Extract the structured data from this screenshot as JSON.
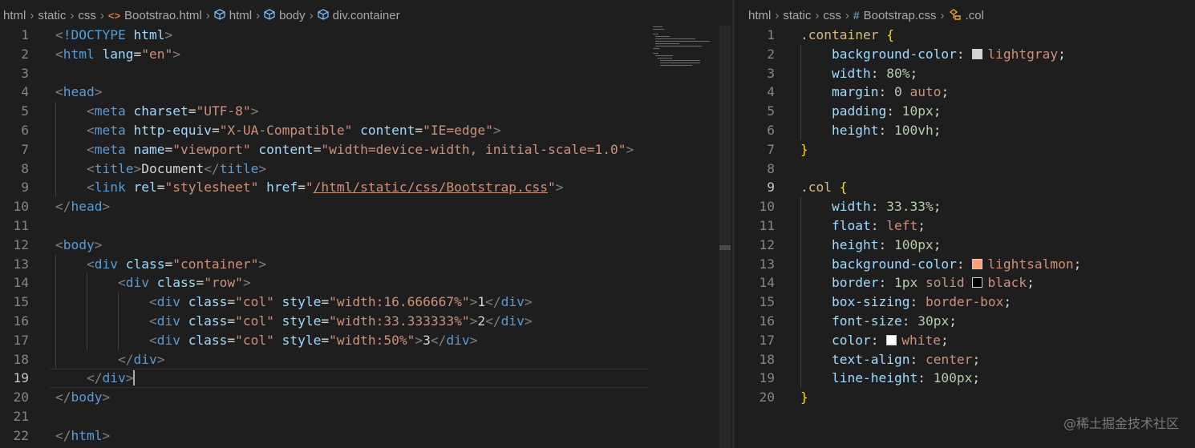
{
  "left_editor": {
    "breadcrumb": [
      {
        "label": "html",
        "icon": ""
      },
      {
        "label": "static",
        "icon": ""
      },
      {
        "label": "css",
        "icon": ""
      },
      {
        "label": "Bootstrao.html",
        "icon": "html-file-icon"
      },
      {
        "label": "html",
        "icon": "cube-icon"
      },
      {
        "label": "body",
        "icon": "cube-icon"
      },
      {
        "label": "div.container",
        "icon": "cube-icon"
      }
    ],
    "line_numbers": [
      "1",
      "2",
      "3",
      "4",
      "5",
      "6",
      "7",
      "8",
      "9",
      "10",
      "11",
      "12",
      "13",
      "14",
      "15",
      "16",
      "17",
      "18",
      "19",
      "20",
      "21",
      "22"
    ],
    "active_line": 19
  },
  "right_editor": {
    "breadcrumb": [
      {
        "label": "html",
        "icon": ""
      },
      {
        "label": "static",
        "icon": ""
      },
      {
        "label": "css",
        "icon": ""
      },
      {
        "label": "Bootstrap.css",
        "icon": "hash-icon"
      },
      {
        "label": ".col",
        "icon": "class-selector-icon"
      }
    ],
    "line_numbers": [
      "1",
      "2",
      "3",
      "4",
      "5",
      "6",
      "7",
      "8",
      "9",
      "10",
      "11",
      "12",
      "13",
      "14",
      "15",
      "16",
      "17",
      "18",
      "19",
      "20"
    ],
    "active_line": 9
  },
  "html_code": [
    [
      [
        "t-brk",
        "<"
      ],
      [
        "t-tag",
        "!DOCTYPE "
      ],
      [
        "t-attr",
        "html"
      ],
      [
        "t-brk",
        ">"
      ]
    ],
    [
      [
        "t-brk",
        "<"
      ],
      [
        "t-tag",
        "html "
      ],
      [
        "t-attr",
        "lang"
      ],
      [
        "t-txt",
        "="
      ],
      [
        "t-str",
        "\"en\""
      ],
      [
        "t-brk",
        ">"
      ]
    ],
    [],
    [
      [
        "t-brk",
        "<"
      ],
      [
        "t-tag",
        "head"
      ],
      [
        "t-brk",
        ">"
      ]
    ],
    [
      [
        "t-txt",
        "    "
      ],
      [
        "t-brk",
        "<"
      ],
      [
        "t-tag",
        "meta "
      ],
      [
        "t-attr",
        "charset"
      ],
      [
        "t-txt",
        "="
      ],
      [
        "t-str",
        "\"UTF-8\""
      ],
      [
        "t-brk",
        ">"
      ]
    ],
    [
      [
        "t-txt",
        "    "
      ],
      [
        "t-brk",
        "<"
      ],
      [
        "t-tag",
        "meta "
      ],
      [
        "t-attr",
        "http-equiv"
      ],
      [
        "t-txt",
        "="
      ],
      [
        "t-str",
        "\"X-UA-Compatible\" "
      ],
      [
        "t-attr",
        "content"
      ],
      [
        "t-txt",
        "="
      ],
      [
        "t-str",
        "\"IE=edge\""
      ],
      [
        "t-brk",
        ">"
      ]
    ],
    [
      [
        "t-txt",
        "    "
      ],
      [
        "t-brk",
        "<"
      ],
      [
        "t-tag",
        "meta "
      ],
      [
        "t-attr",
        "name"
      ],
      [
        "t-txt",
        "="
      ],
      [
        "t-str",
        "\"viewport\" "
      ],
      [
        "t-attr",
        "content"
      ],
      [
        "t-txt",
        "="
      ],
      [
        "t-str",
        "\"width=device-width, initial-scale=1.0\""
      ],
      [
        "t-brk",
        ">"
      ]
    ],
    [
      [
        "t-txt",
        "    "
      ],
      [
        "t-brk",
        "<"
      ],
      [
        "t-tag",
        "title"
      ],
      [
        "t-brk",
        ">"
      ],
      [
        "t-txt",
        "Document"
      ],
      [
        "t-brk",
        "</"
      ],
      [
        "t-tag",
        "title"
      ],
      [
        "t-brk",
        ">"
      ]
    ],
    [
      [
        "t-txt",
        "    "
      ],
      [
        "t-brk",
        "<"
      ],
      [
        "t-tag",
        "link "
      ],
      [
        "t-attr",
        "rel"
      ],
      [
        "t-txt",
        "="
      ],
      [
        "t-str",
        "\"stylesheet\" "
      ],
      [
        "t-attr",
        "href"
      ],
      [
        "t-txt",
        "="
      ],
      [
        "t-str",
        "\""
      ],
      [
        "t-str t-link",
        "/html/static/css/Bootstrap.css"
      ],
      [
        "t-str",
        "\""
      ],
      [
        "t-brk",
        ">"
      ]
    ],
    [
      [
        "t-brk",
        "</"
      ],
      [
        "t-tag",
        "head"
      ],
      [
        "t-brk",
        ">"
      ]
    ],
    [],
    [
      [
        "t-brk",
        "<"
      ],
      [
        "t-tag",
        "body"
      ],
      [
        "t-brk",
        ">"
      ]
    ],
    [
      [
        "t-txt",
        "    "
      ],
      [
        "t-brk",
        "<"
      ],
      [
        "t-tag",
        "div "
      ],
      [
        "t-attr",
        "class"
      ],
      [
        "t-txt",
        "="
      ],
      [
        "t-str",
        "\"container\""
      ],
      [
        "t-brk",
        ">"
      ]
    ],
    [
      [
        "t-txt",
        "        "
      ],
      [
        "t-brk",
        "<"
      ],
      [
        "t-tag",
        "div "
      ],
      [
        "t-attr",
        "class"
      ],
      [
        "t-txt",
        "="
      ],
      [
        "t-str",
        "\"row\""
      ],
      [
        "t-brk",
        ">"
      ]
    ],
    [
      [
        "t-txt",
        "            "
      ],
      [
        "t-brk",
        "<"
      ],
      [
        "t-tag",
        "div "
      ],
      [
        "t-attr",
        "class"
      ],
      [
        "t-txt",
        "="
      ],
      [
        "t-str",
        "\"col\" "
      ],
      [
        "t-attr",
        "style"
      ],
      [
        "t-txt",
        "="
      ],
      [
        "t-str",
        "\"width:16.666667%\""
      ],
      [
        "t-brk",
        ">"
      ],
      [
        "t-txt",
        "1"
      ],
      [
        "t-brk",
        "</"
      ],
      [
        "t-tag",
        "div"
      ],
      [
        "t-brk",
        ">"
      ]
    ],
    [
      [
        "t-txt",
        "            "
      ],
      [
        "t-brk",
        "<"
      ],
      [
        "t-tag",
        "div "
      ],
      [
        "t-attr",
        "class"
      ],
      [
        "t-txt",
        "="
      ],
      [
        "t-str",
        "\"col\" "
      ],
      [
        "t-attr",
        "style"
      ],
      [
        "t-txt",
        "="
      ],
      [
        "t-str",
        "\"width:33.333333%\""
      ],
      [
        "t-brk",
        ">"
      ],
      [
        "t-txt",
        "2"
      ],
      [
        "t-brk",
        "</"
      ],
      [
        "t-tag",
        "div"
      ],
      [
        "t-brk",
        ">"
      ]
    ],
    [
      [
        "t-txt",
        "            "
      ],
      [
        "t-brk",
        "<"
      ],
      [
        "t-tag",
        "div "
      ],
      [
        "t-attr",
        "class"
      ],
      [
        "t-txt",
        "="
      ],
      [
        "t-str",
        "\"col\" "
      ],
      [
        "t-attr",
        "style"
      ],
      [
        "t-txt",
        "="
      ],
      [
        "t-str",
        "\"width:50%\""
      ],
      [
        "t-brk",
        ">"
      ],
      [
        "t-txt",
        "3"
      ],
      [
        "t-brk",
        "</"
      ],
      [
        "t-tag",
        "div"
      ],
      [
        "t-brk",
        ">"
      ]
    ],
    [
      [
        "t-txt",
        "        "
      ],
      [
        "t-brk",
        "</"
      ],
      [
        "t-tag",
        "div"
      ],
      [
        "t-brk",
        ">"
      ]
    ],
    [
      [
        "t-txt",
        "    "
      ],
      [
        "t-brk",
        "</"
      ],
      [
        "t-tag",
        "div"
      ],
      [
        "t-brk",
        ">"
      ],
      [
        "caret",
        ""
      ]
    ],
    [
      [
        "t-brk",
        "</"
      ],
      [
        "t-tag",
        "body"
      ],
      [
        "t-brk",
        ">"
      ]
    ],
    [],
    [
      [
        "t-brk",
        "</"
      ],
      [
        "t-tag",
        "html"
      ],
      [
        "t-brk",
        ">"
      ]
    ]
  ],
  "css_code": [
    [
      [
        "t-sel",
        ".container "
      ],
      [
        "t-brace",
        "{"
      ]
    ],
    [
      [
        "t-txt",
        "    "
      ],
      [
        "t-prop",
        "background-color"
      ],
      [
        "t-punc",
        ": "
      ],
      [
        "swatch",
        "#d3d3d3"
      ],
      [
        "t-val",
        "lightgray"
      ],
      [
        "t-punc",
        ";"
      ]
    ],
    [
      [
        "t-txt",
        "    "
      ],
      [
        "t-prop",
        "width"
      ],
      [
        "t-punc",
        ": "
      ],
      [
        "t-num",
        "80%"
      ],
      [
        "t-punc",
        ";"
      ]
    ],
    [
      [
        "t-txt",
        "    "
      ],
      [
        "t-prop",
        "margin"
      ],
      [
        "t-punc",
        ": "
      ],
      [
        "t-num",
        "0 "
      ],
      [
        "t-val",
        "auto"
      ],
      [
        "t-punc",
        ";"
      ]
    ],
    [
      [
        "t-txt",
        "    "
      ],
      [
        "t-prop",
        "padding"
      ],
      [
        "t-punc",
        ": "
      ],
      [
        "t-num",
        "10px"
      ],
      [
        "t-punc",
        ";"
      ]
    ],
    [
      [
        "t-txt",
        "    "
      ],
      [
        "t-prop",
        "height"
      ],
      [
        "t-punc",
        ": "
      ],
      [
        "t-num",
        "100vh"
      ],
      [
        "t-punc",
        ";"
      ]
    ],
    [
      [
        "t-brace",
        "}"
      ]
    ],
    [],
    [
      [
        "t-sel",
        ".col "
      ],
      [
        "t-brace",
        "{"
      ]
    ],
    [
      [
        "t-txt",
        "    "
      ],
      [
        "t-prop",
        "width"
      ],
      [
        "t-punc",
        ": "
      ],
      [
        "t-num",
        "33.33%"
      ],
      [
        "t-punc",
        ";"
      ]
    ],
    [
      [
        "t-txt",
        "    "
      ],
      [
        "t-prop",
        "float"
      ],
      [
        "t-punc",
        ": "
      ],
      [
        "t-val",
        "left"
      ],
      [
        "t-punc",
        ";"
      ]
    ],
    [
      [
        "t-txt",
        "    "
      ],
      [
        "t-prop",
        "height"
      ],
      [
        "t-punc",
        ": "
      ],
      [
        "t-num",
        "100px"
      ],
      [
        "t-punc",
        ";"
      ]
    ],
    [
      [
        "t-txt",
        "    "
      ],
      [
        "t-prop",
        "background-color"
      ],
      [
        "t-punc",
        ": "
      ],
      [
        "swatch",
        "#ffa07a"
      ],
      [
        "t-val",
        "lightsalmon"
      ],
      [
        "t-punc",
        ";"
      ]
    ],
    [
      [
        "t-txt",
        "    "
      ],
      [
        "t-prop",
        "border"
      ],
      [
        "t-punc",
        ": "
      ],
      [
        "t-num",
        "1px "
      ],
      [
        "t-val",
        "solid "
      ],
      [
        "swatch",
        "#000000"
      ],
      [
        "t-val",
        "black"
      ],
      [
        "t-punc",
        ";"
      ]
    ],
    [
      [
        "t-txt",
        "    "
      ],
      [
        "t-prop",
        "box-sizing"
      ],
      [
        "t-punc",
        ": "
      ],
      [
        "t-val",
        "border-box"
      ],
      [
        "t-punc",
        ";"
      ]
    ],
    [
      [
        "t-txt",
        "    "
      ],
      [
        "t-prop",
        "font-size"
      ],
      [
        "t-punc",
        ": "
      ],
      [
        "t-num",
        "30px"
      ],
      [
        "t-punc",
        ";"
      ]
    ],
    [
      [
        "t-txt",
        "    "
      ],
      [
        "t-prop",
        "color"
      ],
      [
        "t-punc",
        ": "
      ],
      [
        "swatch",
        "#ffffff"
      ],
      [
        "t-val",
        "white"
      ],
      [
        "t-punc",
        ";"
      ]
    ],
    [
      [
        "t-txt",
        "    "
      ],
      [
        "t-prop",
        "text-align"
      ],
      [
        "t-punc",
        ": "
      ],
      [
        "t-val",
        "center"
      ],
      [
        "t-punc",
        ";"
      ]
    ],
    [
      [
        "t-txt",
        "    "
      ],
      [
        "t-prop",
        "line-height"
      ],
      [
        "t-punc",
        ": "
      ],
      [
        "t-num",
        "100px"
      ],
      [
        "t-punc",
        ";"
      ]
    ],
    [
      [
        "t-brace",
        "}"
      ]
    ]
  ],
  "watermark": "@稀土掘金技术社区"
}
